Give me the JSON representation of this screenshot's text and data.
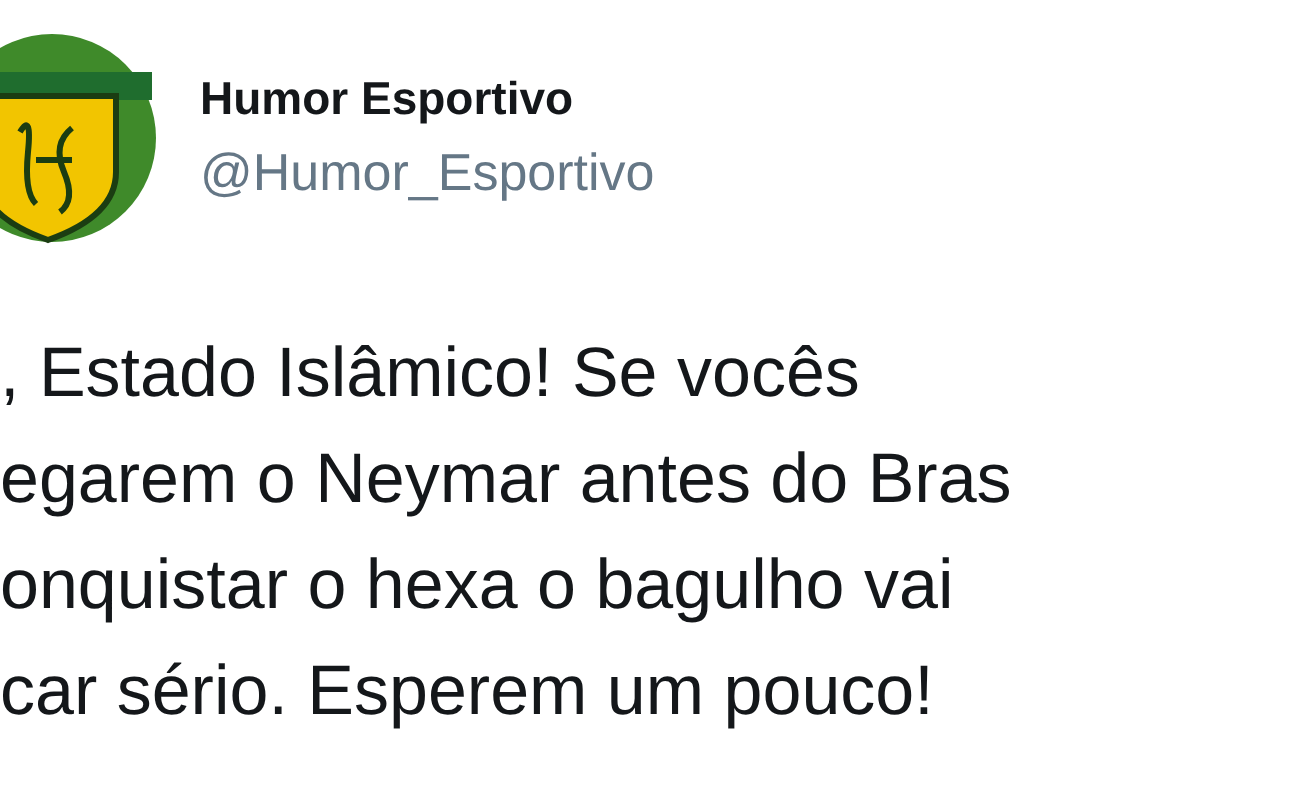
{
  "author": {
    "name": "Humor Esportivo",
    "handle": "@Humor_Esportivo"
  },
  "tweet_lines": [
    ", Estado Islâmico! Se vocês",
    "egarem o Neymar antes do Bras",
    "onquistar o hexa o bagulho vai",
    "car sério. Esperem um pouco!"
  ]
}
